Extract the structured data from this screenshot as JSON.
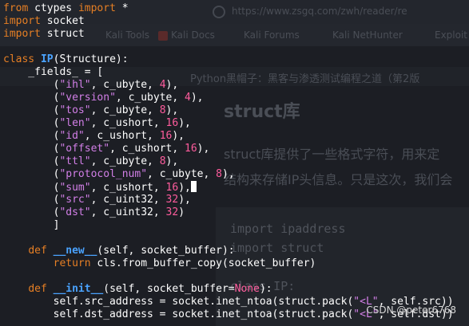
{
  "background_page": {
    "address_bar": "https://www.zsgq.com/zwh/reader/re",
    "bookmarks": [
      "Kali Tools",
      "Kali Docs",
      "Kali Forums",
      "Kali NetHunter",
      "Exploit"
    ],
    "article_tab": "Python黑帽子：黑客与渗透测试编程之道（第2版",
    "heading": "struct库",
    "paragraph_line1": "struct库提供了一些格式字符，用来定",
    "paragraph_line2": "结构来存储IP头信息。只是这次，我们会",
    "code_line1": "import ipaddress",
    "code_line2": "import struct",
    "code_line3": "class IP:"
  },
  "code": {
    "l1": {
      "a": "from",
      "b": " ctypes ",
      "c": "import",
      "d": " *"
    },
    "l2": {
      "a": "import",
      "b": " socket"
    },
    "l3": {
      "a": "import",
      "b": " struct"
    },
    "l5": {
      "a": "class",
      "b": " ",
      "c": "IP",
      "d": "(Structure):"
    },
    "l6": "    _fields_ = [",
    "fields": [
      {
        "name": "\"ihl\"",
        "type": "c_ubyte",
        "bits": "4"
      },
      {
        "name": "\"version\"",
        "type": "c_ubyte",
        "bits": "4"
      },
      {
        "name": "\"tos\"",
        "type": "c_ubyte",
        "bits": "8"
      },
      {
        "name": "\"len\"",
        "type": "c_ushort",
        "bits": "16"
      },
      {
        "name": "\"id\"",
        "type": "c_ushort",
        "bits": "16"
      },
      {
        "name": "\"offset\"",
        "type": "c_ushort",
        "bits": "16"
      },
      {
        "name": "\"ttl\"",
        "type": "c_ubyte",
        "bits": "8"
      },
      {
        "name": "\"protocol_num\"",
        "type": "c_ubyte",
        "bits": "8"
      },
      {
        "name": "\"sum\"",
        "type": "c_ushort",
        "bits": "16"
      },
      {
        "name": "\"src\"",
        "type": "c_uint32",
        "bits": "32"
      },
      {
        "name": "\"dst\"",
        "type": "c_uint32",
        "bits": "32"
      }
    ],
    "l18": "        ]",
    "l20": {
      "a": "    ",
      "b": "def",
      "c": " ",
      "d": "__new__",
      "e": "(self, socket_buffer):"
    },
    "l21": {
      "a": "        ",
      "b": "return",
      "c": " cls.from_buffer_copy(socket_buffer)"
    },
    "l23": {
      "a": "    ",
      "b": "def",
      "c": " ",
      "d": "__init__",
      "e": "(self, socket_buffer=",
      "f": "None",
      "g": "):"
    },
    "l24": {
      "a": "        self.src_address = socket.inet_ntoa(struct.pack(",
      "b": "\"<L\"",
      "c": ", self.src))"
    },
    "l25": {
      "a": "        self.dst_address = socket.inet_ntoa(struct.pack(",
      "b": "\"<L\"",
      "c": ", self.dst))"
    }
  },
  "watermark": "CSDN @peter6768",
  "colors": {
    "background": "#1c1e24",
    "keyword": "#e67f24",
    "class_name": "#4aa3ff",
    "string": "#d27fe7",
    "number": "#ff5c9d",
    "text": "#ffffff"
  }
}
